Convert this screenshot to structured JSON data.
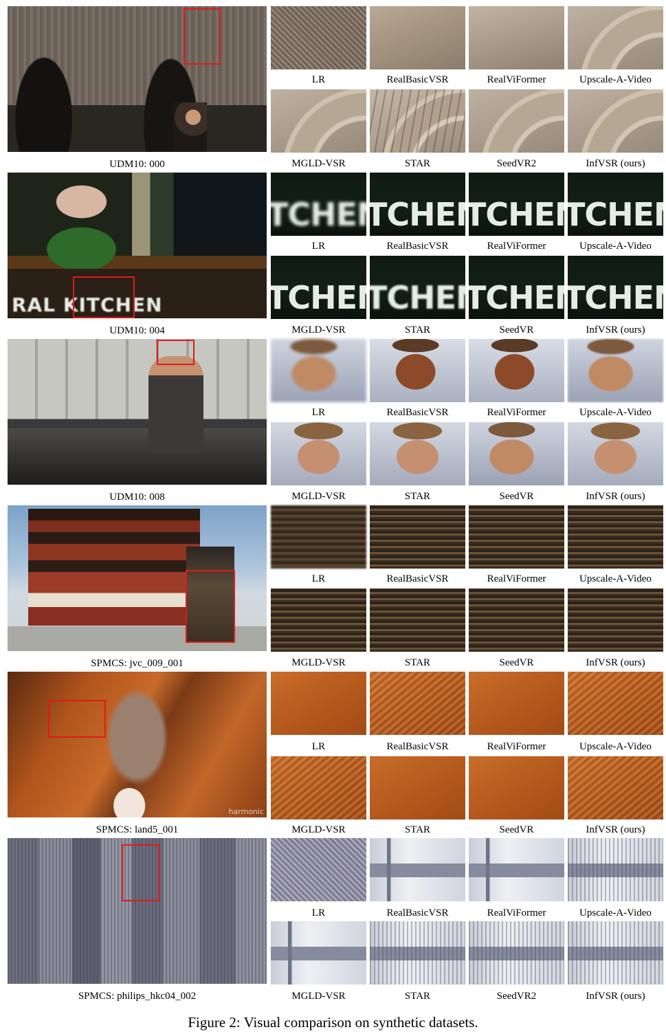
{
  "figure": {
    "caption": "Figure 2: Visual comparison on synthetic datasets.",
    "rows": [
      {
        "scene": "UDM10: 000",
        "methods_top": [
          "LR",
          "RealBasicVSR",
          "RealViFormer",
          "Upscale-A-Video"
        ],
        "methods_bottom": [
          "MGLD-VSR",
          "STAR",
          "SeedVR2",
          "InfVSR (ours)"
        ]
      },
      {
        "scene": "UDM10: 004",
        "sign_text": "RAL KITCHEN",
        "crop_text": "TCHEN",
        "methods_top": [
          "LR",
          "RealBasicVSR",
          "RealViFormer",
          "Upscale-A-Video"
        ],
        "methods_bottom": [
          "MGLD-VSR",
          "STAR",
          "SeedVR",
          "InfVSR (ours)"
        ]
      },
      {
        "scene": "UDM10: 008",
        "methods_top": [
          "LR",
          "RealBasicVSR",
          "RealViFormer",
          "Upscale-A-Video"
        ],
        "methods_bottom": [
          "MGLD-VSR",
          "STAR",
          "SeedVR",
          "InfVSR (ours)"
        ]
      },
      {
        "scene": "SPMCS: jvc_009_001",
        "methods_top": [
          "LR",
          "RealBasicVSR",
          "RealViFormer",
          "Upscale-A-Video"
        ],
        "methods_bottom": [
          "MGLD-VSR",
          "STAR",
          "SeedVR",
          "InfVSR (ours)"
        ]
      },
      {
        "scene": "SPMCS: land5_001",
        "watermark": "harmonic",
        "methods_top": [
          "LR",
          "RealBasicVSR",
          "RealViFormer",
          "Upscale-A-Video"
        ],
        "methods_bottom": [
          "MGLD-VSR",
          "STAR",
          "SeedVR",
          "InfVSR (ours)"
        ]
      },
      {
        "scene": "SPMCS: philips_hkc04_002",
        "methods_top": [
          "LR",
          "RealBasicVSR",
          "RealViFormer",
          "Upscale-A-Video"
        ],
        "methods_bottom": [
          "MGLD-VSR",
          "STAR",
          "SeedVR2",
          "InfVSR (ours)"
        ]
      }
    ]
  }
}
